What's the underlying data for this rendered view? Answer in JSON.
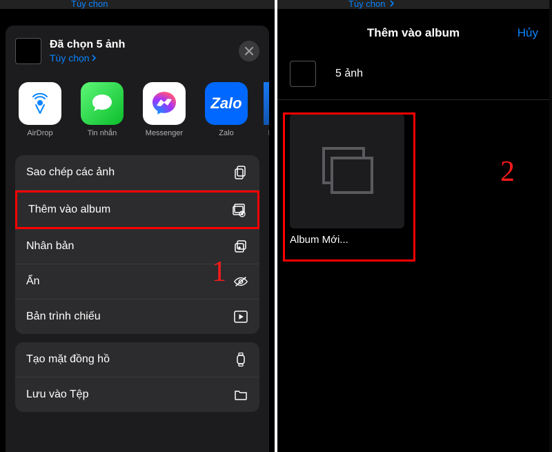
{
  "left": {
    "options_peek": "Tùy chon",
    "header": {
      "title": "Đã chọn 5 ảnh",
      "options": "Tùy chọn"
    },
    "apps": [
      {
        "key": "airdrop",
        "label": "AirDrop"
      },
      {
        "key": "messages",
        "label": "Tin nhắn"
      },
      {
        "key": "messenger",
        "label": "Messenger"
      },
      {
        "key": "zalo",
        "label": "Zalo"
      },
      {
        "key": "facebook",
        "label": "F"
      }
    ],
    "list1": [
      {
        "label": "Sao chép các ảnh",
        "icon": "copy"
      },
      {
        "label": "Thêm vào album",
        "icon": "album-add",
        "highlight": true
      },
      {
        "label": "Nhân bản",
        "icon": "duplicate"
      },
      {
        "label": "Ẩn",
        "icon": "hide"
      },
      {
        "label": "Bản trình chiếu",
        "icon": "play"
      }
    ],
    "list2": [
      {
        "label": "Tạo mặt đồng hồ",
        "icon": "watch"
      },
      {
        "label": "Lưu vào Tệp",
        "icon": "folder"
      }
    ],
    "marker": "1"
  },
  "right": {
    "options_peek": "Tùy chon",
    "nav_title": "Thêm vào album",
    "nav_cancel": "Hủy",
    "subtitle": "5 ảnh",
    "album_name": "Album Mới...",
    "marker": "2"
  }
}
